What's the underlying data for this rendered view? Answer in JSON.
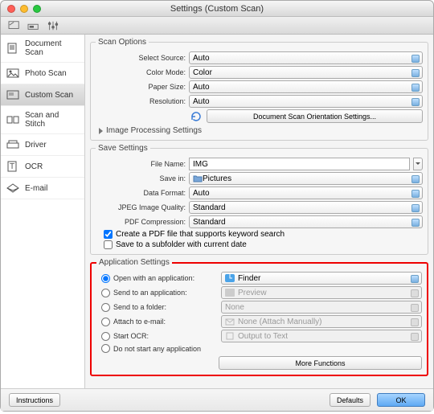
{
  "window": {
    "title": "Settings (Custom Scan)"
  },
  "sidebar": {
    "items": [
      {
        "label": "Document Scan"
      },
      {
        "label": "Photo Scan"
      },
      {
        "label": "Custom Scan"
      },
      {
        "label": "Scan and Stitch"
      },
      {
        "label": "Driver"
      },
      {
        "label": "OCR"
      },
      {
        "label": "E-mail"
      }
    ]
  },
  "scan_options": {
    "legend": "Scan Options",
    "select_source": {
      "label": "Select Source:",
      "value": "Auto"
    },
    "color_mode": {
      "label": "Color Mode:",
      "value": "Color"
    },
    "paper_size": {
      "label": "Paper Size:",
      "value": "Auto"
    },
    "resolution": {
      "label": "Resolution:",
      "value": "Auto"
    },
    "orientation_btn": "Document Scan Orientation Settings...",
    "image_processing": "Image Processing Settings"
  },
  "save_settings": {
    "legend": "Save Settings",
    "file_name": {
      "label": "File Name:",
      "value": "IMG"
    },
    "save_in": {
      "label": "Save in:",
      "value": "Pictures"
    },
    "data_format": {
      "label": "Data Format:",
      "value": "Auto"
    },
    "jpeg_quality": {
      "label": "JPEG Image Quality:",
      "value": "Standard"
    },
    "pdf_compression": {
      "label": "PDF Compression:",
      "value": "Standard"
    },
    "pdf_keyword": "Create a PDF file that supports keyword search",
    "subfolder": "Save to a subfolder with current date"
  },
  "app_settings": {
    "legend": "Application Settings",
    "open_with": {
      "label": "Open with an application:",
      "value": "Finder"
    },
    "send_to_app": {
      "label": "Send to an application:",
      "value": "Preview"
    },
    "send_to_folder": {
      "label": "Send to a folder:",
      "value": "None"
    },
    "attach_email": {
      "label": "Attach to e-mail:",
      "value": "None (Attach Manually)"
    },
    "start_ocr": {
      "label": "Start OCR:",
      "value": "Output to Text"
    },
    "do_not_start": "Do not start any application",
    "more_functions": "More Functions"
  },
  "footer": {
    "instructions": "Instructions",
    "defaults": "Defaults",
    "ok": "OK"
  }
}
